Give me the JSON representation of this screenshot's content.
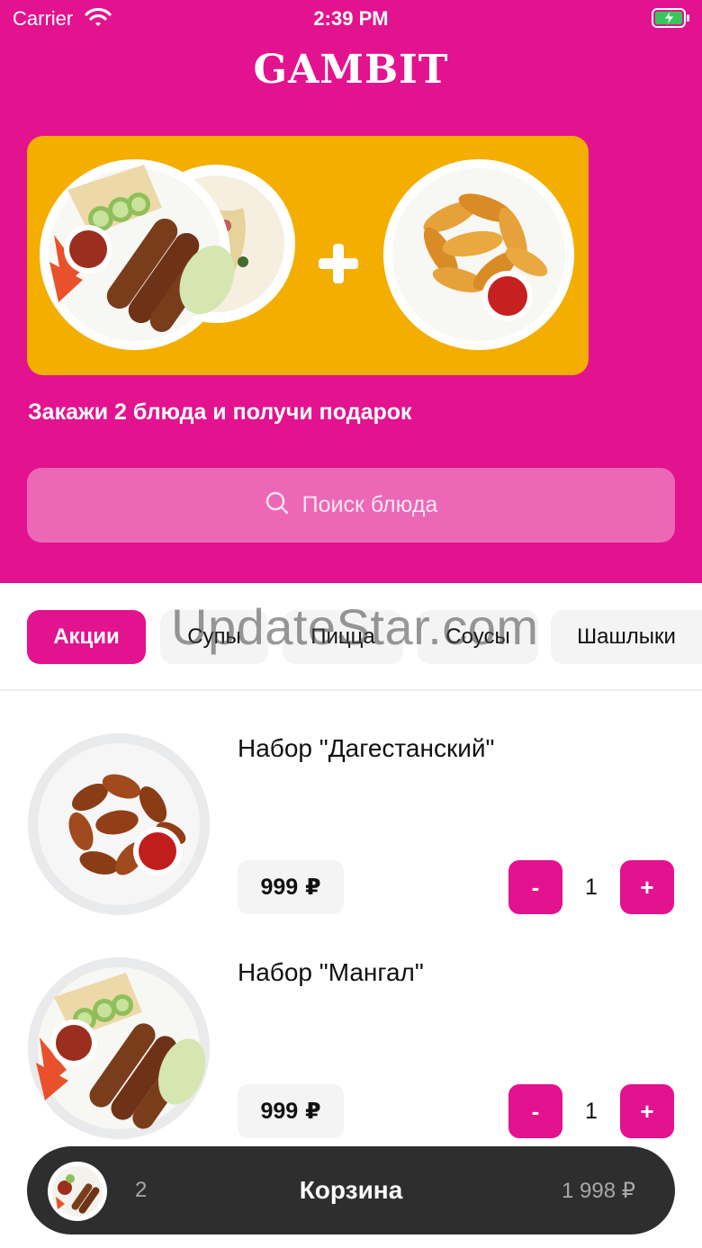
{
  "status_bar": {
    "carrier": "Carrier",
    "time": "2:39 PM"
  },
  "app": {
    "logo": "GAMBIT"
  },
  "promo": {
    "caption": "Закажи 2 блюда и получи подарок",
    "background": "#f3ae00"
  },
  "search": {
    "placeholder": "Поиск блюда"
  },
  "categories": [
    {
      "label": "Акции",
      "active": true
    },
    {
      "label": "Супы",
      "active": false
    },
    {
      "label": "Пицца",
      "active": false
    },
    {
      "label": "Соусы",
      "active": false
    },
    {
      "label": "Шашлыки",
      "active": false
    }
  ],
  "watermark": "UpdateStar.com",
  "products": [
    {
      "name": "Набор \"Дагестанский\"",
      "price": "999",
      "currency": "₽",
      "quantity": "1",
      "minus": "-",
      "plus": "+"
    },
    {
      "name": "Набор \"Мангал\"",
      "price": "999",
      "currency": "₽",
      "quantity": "1",
      "minus": "-",
      "plus": "+"
    }
  ],
  "cart": {
    "count": "2",
    "title": "Корзина",
    "total": "1 998 ₽"
  },
  "colors": {
    "accent": "#e3128e",
    "cart_bar": "#2e2e2e"
  },
  "icons": [
    "wifi-icon",
    "battery-icon",
    "search-icon",
    "plus-icon"
  ]
}
